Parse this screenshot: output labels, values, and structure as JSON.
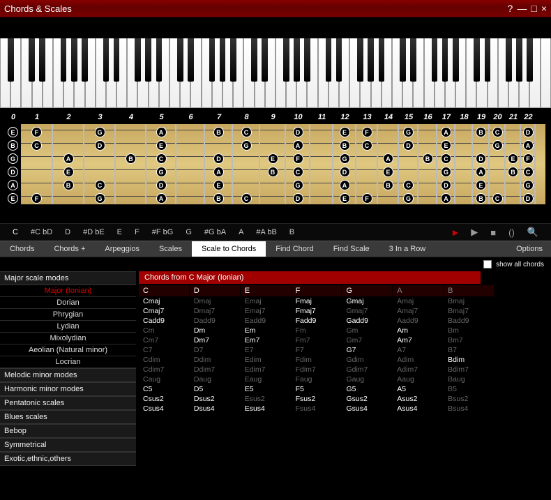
{
  "title": "Chords & Scales",
  "titlebar_icons": {
    "help": "?",
    "min": "—",
    "max": "□",
    "close": "×"
  },
  "note_row": [
    "C",
    "#C  bD",
    "D",
    "#D  bE",
    "E",
    "F",
    "#F  bG",
    "G",
    "#G  bA",
    "A",
    "#A  bB",
    "B"
  ],
  "note_row_active": 0,
  "tabs": [
    "Chords",
    "Chords +",
    "Arpeggios",
    "Scales",
    "Scale to Chords",
    "Find Chord",
    "Find Scale",
    "3 In a Row"
  ],
  "tabs_active": 4,
  "options_label": "Options",
  "show_all_label": "show all chords",
  "panel_title": "Chords from C Major (Ionian)",
  "sidebar": [
    {
      "type": "header",
      "label": "Major scale modes"
    },
    {
      "type": "item",
      "label": "Major (Ionian)",
      "sel": true
    },
    {
      "type": "item",
      "label": "Dorian"
    },
    {
      "type": "item",
      "label": "Phrygian"
    },
    {
      "type": "item",
      "label": "Lydian"
    },
    {
      "type": "item",
      "label": "Mixolydian"
    },
    {
      "type": "item",
      "label": "Aeolian (Natural minor)"
    },
    {
      "type": "item",
      "label": "Locrian"
    },
    {
      "type": "header",
      "label": "Melodic minor modes"
    },
    {
      "type": "header",
      "label": "Harmonic minor modes"
    },
    {
      "type": "header",
      "label": "Pentatonic scales"
    },
    {
      "type": "header",
      "label": "Blues scales"
    },
    {
      "type": "header",
      "label": "Bebop"
    },
    {
      "type": "header",
      "label": "Symmetrical"
    },
    {
      "type": "header",
      "label": "Exotic,ethnic,others"
    }
  ],
  "root_header": [
    {
      "l": "C",
      "on": true
    },
    {
      "l": "D",
      "on": true
    },
    {
      "l": "E",
      "on": true
    },
    {
      "l": "F",
      "on": true
    },
    {
      "l": "G",
      "on": true
    },
    {
      "l": "A",
      "on": false
    },
    {
      "l": "B",
      "on": false
    }
  ],
  "chord_rows": [
    [
      {
        "l": "Cmaj",
        "on": true
      },
      {
        "l": "Dmaj",
        "on": false
      },
      {
        "l": "Emaj",
        "on": false
      },
      {
        "l": "Fmaj",
        "on": true
      },
      {
        "l": "Gmaj",
        "on": true
      },
      {
        "l": "Amaj",
        "on": false
      },
      {
        "l": "Bmaj",
        "on": false
      }
    ],
    [
      {
        "l": "Cmaj7",
        "on": true
      },
      {
        "l": "Dmaj7",
        "on": false
      },
      {
        "l": "Emaj7",
        "on": false
      },
      {
        "l": "Fmaj7",
        "on": true
      },
      {
        "l": "Gmaj7",
        "on": false
      },
      {
        "l": "Amaj7",
        "on": false
      },
      {
        "l": "Bmaj7",
        "on": false
      }
    ],
    [
      {
        "l": "Cadd9",
        "on": true
      },
      {
        "l": "Dadd9",
        "on": false
      },
      {
        "l": "Eadd9",
        "on": false
      },
      {
        "l": "Fadd9",
        "on": true
      },
      {
        "l": "Gadd9",
        "on": true
      },
      {
        "l": "Aadd9",
        "on": false
      },
      {
        "l": "Badd9",
        "on": false
      }
    ],
    [
      {
        "l": "Cm",
        "on": false
      },
      {
        "l": "Dm",
        "on": true
      },
      {
        "l": "Em",
        "on": true
      },
      {
        "l": "Fm",
        "on": false
      },
      {
        "l": "Gm",
        "on": false
      },
      {
        "l": "Am",
        "on": true
      },
      {
        "l": "Bm",
        "on": false
      }
    ],
    [
      {
        "l": "Cm7",
        "on": false
      },
      {
        "l": "Dm7",
        "on": true
      },
      {
        "l": "Em7",
        "on": true
      },
      {
        "l": "Fm7",
        "on": false
      },
      {
        "l": "Gm7",
        "on": false
      },
      {
        "l": "Am7",
        "on": true
      },
      {
        "l": "Bm7",
        "on": false
      }
    ],
    [
      {
        "l": "C7",
        "on": false
      },
      {
        "l": "D7",
        "on": false
      },
      {
        "l": "E7",
        "on": false
      },
      {
        "l": "F7",
        "on": false
      },
      {
        "l": "G7",
        "on": true
      },
      {
        "l": "A7",
        "on": false
      },
      {
        "l": "B7",
        "on": false
      }
    ],
    [
      {
        "l": "Cdim",
        "on": false
      },
      {
        "l": "Ddim",
        "on": false
      },
      {
        "l": "Edim",
        "on": false
      },
      {
        "l": "Fdim",
        "on": false
      },
      {
        "l": "Gdim",
        "on": false
      },
      {
        "l": "Adim",
        "on": false
      },
      {
        "l": "Bdim",
        "on": true
      }
    ],
    [
      {
        "l": "Cdim7",
        "on": false
      },
      {
        "l": "Ddim7",
        "on": false
      },
      {
        "l": "Edim7",
        "on": false
      },
      {
        "l": "Fdim7",
        "on": false
      },
      {
        "l": "Gdim7",
        "on": false
      },
      {
        "l": "Adim7",
        "on": false
      },
      {
        "l": "Bdim7",
        "on": false
      }
    ],
    [
      {
        "l": "Caug",
        "on": false
      },
      {
        "l": "Daug",
        "on": false
      },
      {
        "l": "Eaug",
        "on": false
      },
      {
        "l": "Faug",
        "on": false
      },
      {
        "l": "Gaug",
        "on": false
      },
      {
        "l": "Aaug",
        "on": false
      },
      {
        "l": "Baug",
        "on": false
      }
    ],
    [
      {
        "l": "C5",
        "on": true
      },
      {
        "l": "D5",
        "on": true
      },
      {
        "l": "E5",
        "on": true
      },
      {
        "l": "F5",
        "on": true
      },
      {
        "l": "G5",
        "on": true
      },
      {
        "l": "A5",
        "on": true
      },
      {
        "l": "B5",
        "on": false
      }
    ],
    [
      {
        "l": "Csus2",
        "on": true
      },
      {
        "l": "Dsus2",
        "on": true
      },
      {
        "l": "Esus2",
        "on": false
      },
      {
        "l": "Fsus2",
        "on": true
      },
      {
        "l": "Gsus2",
        "on": true
      },
      {
        "l": "Asus2",
        "on": true
      },
      {
        "l": "Bsus2",
        "on": false
      }
    ],
    [
      {
        "l": "Csus4",
        "on": true
      },
      {
        "l": "Dsus4",
        "on": true
      },
      {
        "l": "Esus4",
        "on": true
      },
      {
        "l": "Fsus4",
        "on": false
      },
      {
        "l": "Gsus4",
        "on": true
      },
      {
        "l": "Asus4",
        "on": true
      },
      {
        "l": "Bsus4",
        "on": false
      }
    ]
  ],
  "fret_count": 22,
  "fret_widths": [
    46,
    45,
    45,
    44,
    43,
    41,
    40,
    39,
    37,
    35,
    33,
    33,
    31,
    30,
    28,
    27,
    26,
    25,
    24,
    23,
    22,
    21
  ],
  "strings_open": [
    "E",
    "B",
    "G",
    "D",
    "A",
    "E"
  ],
  "fretboard_notes": {
    "0": {
      "0": "E",
      "1": "B",
      "2": "G",
      "3": "D",
      "4": "A",
      "5": "E"
    },
    "1": {
      "0": "F",
      "1": "C",
      "5": "F"
    },
    "2": {
      "2": "A",
      "3": "E",
      "4": "B"
    },
    "3": {
      "0": "G",
      "1": "D",
      "4": "C",
      "5": "G"
    },
    "4": {
      "2": "B"
    },
    "5": {
      "0": "A",
      "1": "E",
      "2": "C",
      "3": "G",
      "4": "D",
      "5": "A"
    },
    "6": {
      "5": ""
    },
    "7": {
      "0": "B",
      "2": "D",
      "3": "A",
      "4": "E",
      "5": "B"
    },
    "8": {
      "0": "C",
      "1": "G",
      "5": "C"
    },
    "9": {
      "2": "E",
      "3": "B"
    },
    "10": {
      "0": "D",
      "1": "A",
      "2": "F",
      "3": "C",
      "4": "G",
      "5": "D"
    },
    "12": {
      "0": "E",
      "1": "B",
      "2": "G",
      "3": "D",
      "4": "A",
      "5": "E"
    },
    "13": {
      "0": "F",
      "1": "C",
      "5": "F"
    },
    "14": {
      "2": "A",
      "3": "E",
      "4": "B"
    },
    "15": {
      "0": "G",
      "1": "D",
      "4": "C",
      "5": "G"
    },
    "16": {
      "2": "B"
    },
    "17": {
      "0": "A",
      "1": "E",
      "2": "C",
      "3": "G",
      "4": "D",
      "5": "A"
    },
    "19": {
      "0": "B",
      "2": "D",
      "3": "A",
      "4": "E",
      "5": "B"
    },
    "20": {
      "0": "C",
      "1": "G",
      "5": "C"
    },
    "21": {
      "2": "E",
      "3": "B"
    },
    "22": {
      "0": "D",
      "1": "A",
      "2": "F",
      "3": "C",
      "4": "G",
      "5": "D"
    }
  }
}
